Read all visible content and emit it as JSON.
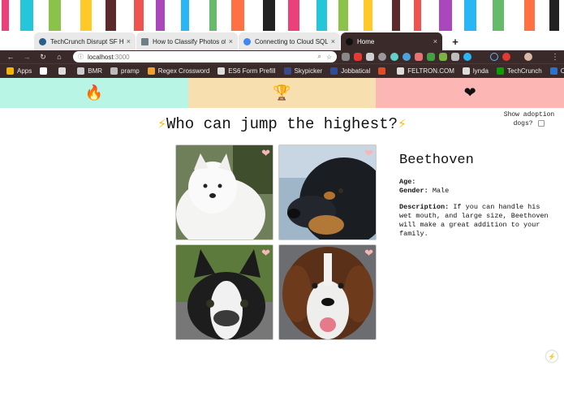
{
  "browser": {
    "tabs": [
      {
        "title": "TechCrunch Disrupt SF Hackat",
        "close": "×",
        "favicon_color": "#2a5d87",
        "active": false
      },
      {
        "title": "How to Classify Photos of Dog",
        "close": "×",
        "favicon_color": "#6f7f88",
        "active": false
      },
      {
        "title": "Connecting to Cloud SQL from",
        "close": "×",
        "favicon_color": "#4285f4",
        "active": false
      },
      {
        "title": "Home",
        "close": "×",
        "favicon_color": "#111111",
        "active": true
      }
    ],
    "new_tab": "+",
    "url_host": "localhost",
    "url_port": ":3000",
    "bookmarks": [
      {
        "label": "Apps",
        "color": "#f4b400"
      },
      {
        "label": "",
        "color": "#ffffff"
      },
      {
        "label": "",
        "color": "#dddddd"
      },
      {
        "label": "BMR",
        "color": "#cccccc"
      },
      {
        "label": "pramp",
        "color": "#bbbbbb"
      },
      {
        "label": "Regex Crossword",
        "color": "#f0a030"
      },
      {
        "label": "ES6 Form Prefill",
        "color": "#dddddd"
      },
      {
        "label": "Skypicker",
        "color": "#3a4b8c"
      },
      {
        "label": "Jobbatical",
        "color": "#2d4d9c"
      },
      {
        "label": "",
        "color": "#e34b25"
      },
      {
        "label": "FELTRON.COM",
        "color": "#dddddd"
      },
      {
        "label": "lynda",
        "color": "#dddddd"
      },
      {
        "label": "TechCrunch",
        "color": "#0a9e01"
      },
      {
        "label": "Coursera",
        "color": "#2a73cc"
      }
    ],
    "bookmarks_more": "»"
  },
  "nav": {
    "tabs": [
      {
        "icon": "🔥",
        "icon_name": "fire-icon",
        "color": "#b9f5e5"
      },
      {
        "icon": "🏆",
        "icon_name": "trophy-icon",
        "color": "#f8dfb0"
      },
      {
        "icon": "❤",
        "icon_name": "heart-icon",
        "color": "#fcb6b4"
      }
    ]
  },
  "adoption_toggle": {
    "label": "Show adoption dogs?",
    "checked": false
  },
  "question": {
    "bolt": "⚡",
    "text": "Who can jump the highest?"
  },
  "dogs": [
    {
      "alt": "white fluffy puppy",
      "liked": false
    },
    {
      "alt": "black and tan dog",
      "liked": false
    },
    {
      "alt": "boston terrier",
      "liked": false
    },
    {
      "alt": "saint bernard",
      "liked": false
    }
  ],
  "selected_dog": {
    "name": "Beethoven",
    "age_label": "Age:",
    "age_value": "",
    "gender_label": "Gender:",
    "gender_value": "Male",
    "description_label": "Description:",
    "description_value": "If you can handle his wet mouth, and large size, Beethoven will make a great addition to your family."
  },
  "fab_icon": "⚡"
}
